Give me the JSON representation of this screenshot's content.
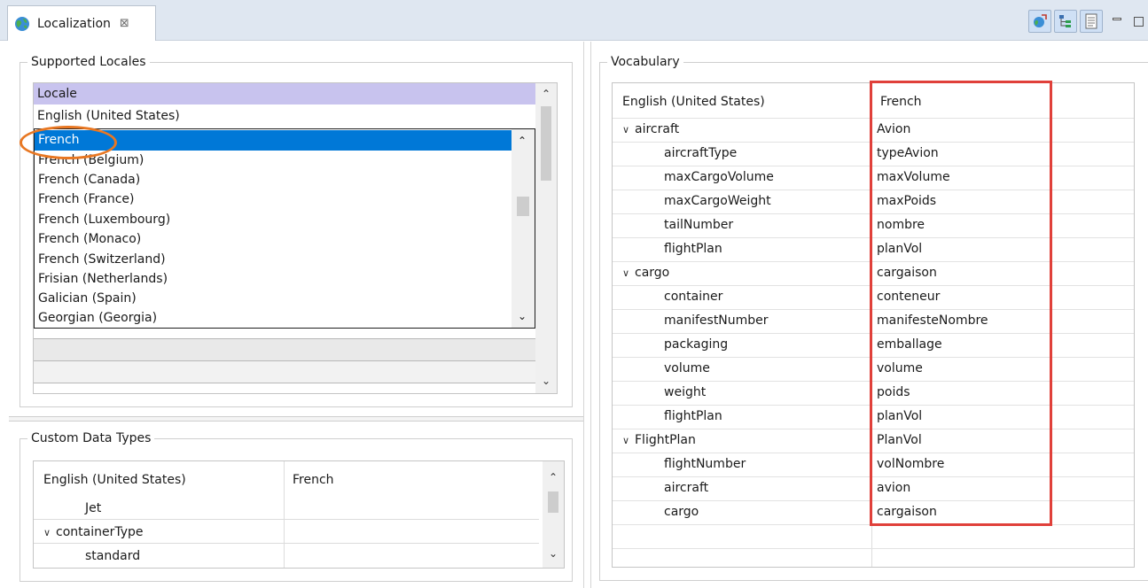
{
  "tab": {
    "title": "Localization",
    "close_glyph": "⊠",
    "icon": "globe-icon"
  },
  "toolbar": {
    "buttons": [
      {
        "icon": "globe-refresh-icon"
      },
      {
        "icon": "tree-view-icon"
      },
      {
        "icon": "document-icon"
      }
    ],
    "minimize_icon": "minimize-icon",
    "maximize_icon": "maximize-icon"
  },
  "supported_locales": {
    "legend": "Supported Locales",
    "header": "Locale",
    "rows": [
      "English (United States)"
    ],
    "dropdown": {
      "selected": "French",
      "options": [
        "French",
        "French (Belgium)",
        "French (Canada)",
        "French (France)",
        "French (Luxembourg)",
        "French (Monaco)",
        "French (Switzerland)",
        "Frisian (Netherlands)",
        "Galician (Spain)",
        "Georgian (Georgia)"
      ]
    }
  },
  "custom_data_types": {
    "legend": "Custom Data Types",
    "columns": [
      "English (United States)",
      "French"
    ],
    "rows": [
      {
        "source": "Jet",
        "target": "",
        "level": 1,
        "expander": false
      },
      {
        "source": "containerType",
        "target": "",
        "level": 0,
        "expander": true
      },
      {
        "source": "standard",
        "target": "",
        "level": 1,
        "expander": false
      }
    ]
  },
  "vocabulary": {
    "legend": "Vocabulary",
    "columns": [
      "English (United States)",
      "French"
    ],
    "rows": [
      {
        "source": "aircraft",
        "target": "Avion",
        "level": 0,
        "expander": true
      },
      {
        "source": "aircraftType",
        "target": "typeAvion",
        "level": 1,
        "expander": false
      },
      {
        "source": "maxCargoVolume",
        "target": "maxVolume",
        "level": 1,
        "expander": false
      },
      {
        "source": "maxCargoWeight",
        "target": "maxPoids",
        "level": 1,
        "expander": false
      },
      {
        "source": "tailNumber",
        "target": "nombre",
        "level": 1,
        "expander": false
      },
      {
        "source": "flightPlan",
        "target": "planVol",
        "level": 1,
        "expander": false
      },
      {
        "source": "cargo",
        "target": "cargaison",
        "level": 0,
        "expander": true
      },
      {
        "source": "container",
        "target": "conteneur",
        "level": 1,
        "expander": false
      },
      {
        "source": "manifestNumber",
        "target": "manifesteNombre",
        "level": 1,
        "expander": false
      },
      {
        "source": "packaging",
        "target": "emballage",
        "level": 1,
        "expander": false
      },
      {
        "source": "volume",
        "target": "volume",
        "level": 1,
        "expander": false
      },
      {
        "source": "weight",
        "target": "poids",
        "level": 1,
        "expander": false
      },
      {
        "source": "flightPlan",
        "target": "planVol",
        "level": 1,
        "expander": false
      },
      {
        "source": "FlightPlan",
        "target": "PlanVol",
        "level": 0,
        "expander": true
      },
      {
        "source": "flightNumber",
        "target": "volNombre",
        "level": 1,
        "expander": false
      },
      {
        "source": "aircraft",
        "target": "avion",
        "level": 1,
        "expander": false
      },
      {
        "source": "cargo",
        "target": "cargaison",
        "level": 1,
        "expander": false
      }
    ]
  },
  "annotations": {
    "highlight_box_color": "#e0403a",
    "ellipse_color": "#e87722"
  }
}
